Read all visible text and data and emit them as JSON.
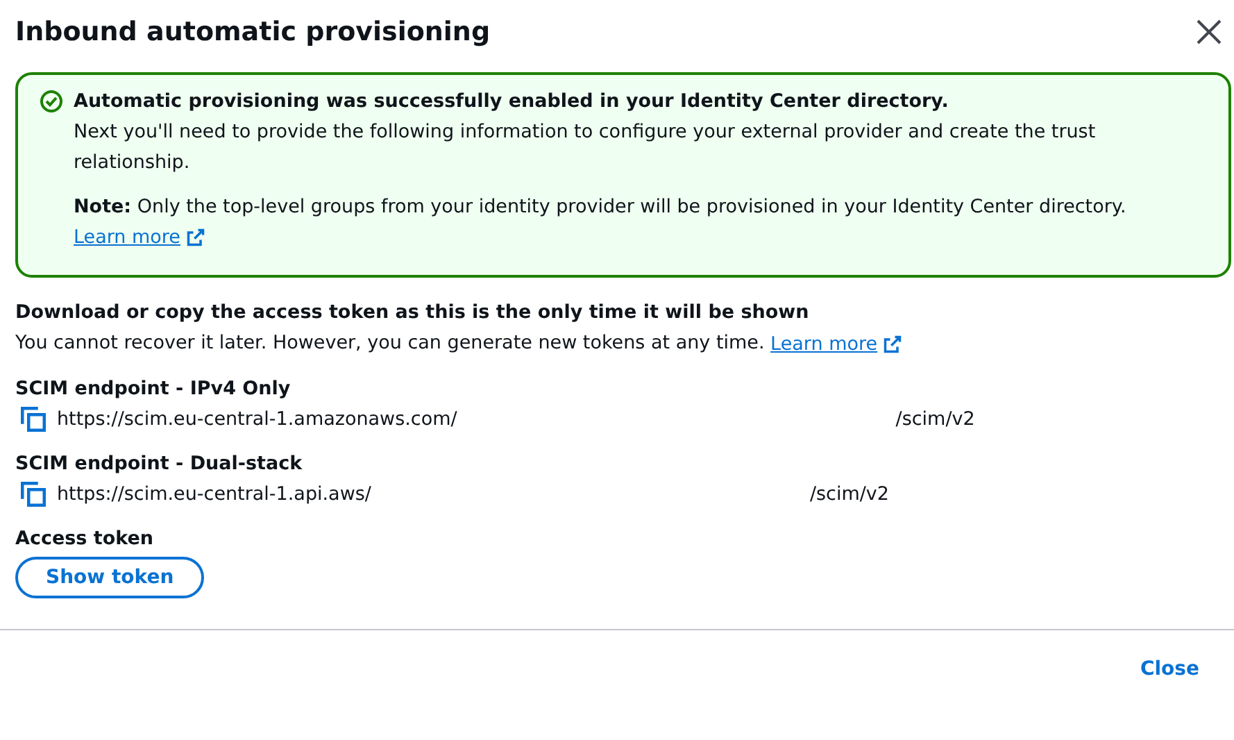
{
  "dialog": {
    "title": "Inbound automatic provisioning"
  },
  "alert": {
    "kind": "success",
    "heading": "Automatic provisioning was successfully enabled in your Identity Center directory.",
    "body": "Next you'll need to provide the following information to configure your external provider and create the trust relationship.",
    "note": "**Note:** Only the top-level groups from your identity provider will be provisioned in your Identity Center directory.",
    "link": "Learn more"
  },
  "token_info": {
    "heading": "Download or copy the access token as this is the only time it will be shown",
    "text": "You cannot recover it later. However, you can generate new tokens at any time.",
    "link": "Learn more"
  },
  "endpoints": [
    {
      "label": "SCIM endpoint - IPv4 Only",
      "url_start": "https://scim.eu-central-1.amazonaws.com/",
      "url_end": "/scim/v2"
    },
    {
      "label": "SCIM endpoint - Dual-stack",
      "url_start": "https://scim.eu-central-1.api.aws/",
      "url_end": "/scim/v2"
    }
  ],
  "access_token": {
    "label": "Access token",
    "button": "Show token"
  },
  "footer": {
    "button": "Close"
  }
}
